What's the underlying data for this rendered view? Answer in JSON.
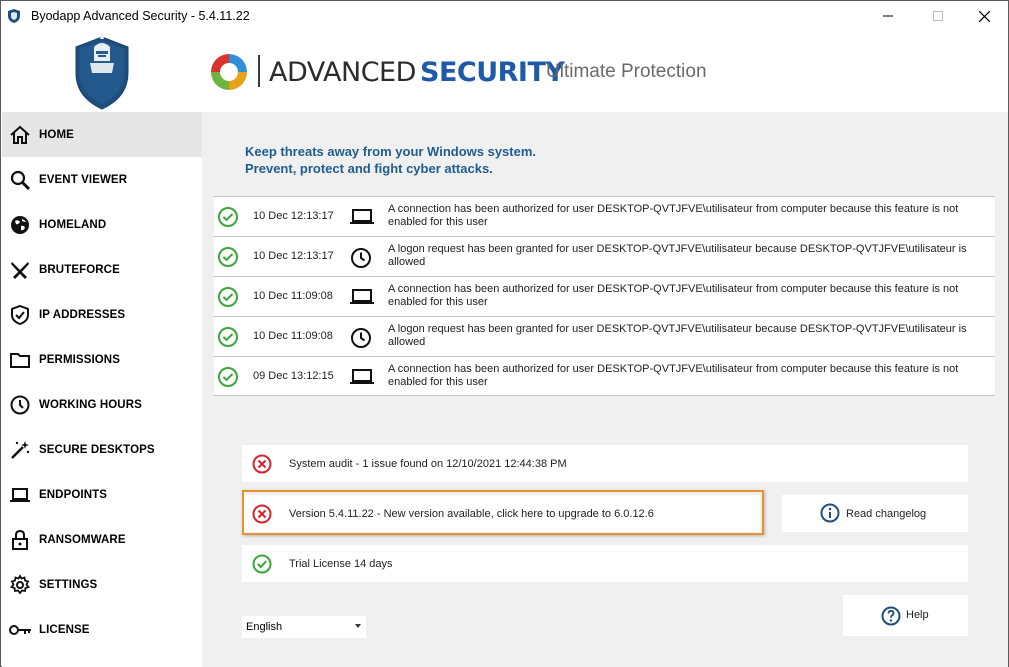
{
  "window": {
    "title": "Byodapp Advanced Security - 5.4.11.22"
  },
  "header": {
    "brand_advanced": "ADVANCED",
    "brand_security": "SECURITY",
    "tagline": "Ultimate Protection"
  },
  "sidebar": {
    "items": [
      {
        "label": "HOME",
        "icon": "home-icon",
        "active": true
      },
      {
        "label": "EVENT VIEWER",
        "icon": "magnifier-icon"
      },
      {
        "label": "HOMELAND",
        "icon": "globe-icon"
      },
      {
        "label": "BRUTEFORCE",
        "icon": "crossed-swords-icon"
      },
      {
        "label": "IP ADDRESSES",
        "icon": "shield-check-icon"
      },
      {
        "label": "PERMISSIONS",
        "icon": "folder-icon"
      },
      {
        "label": "WORKING HOURS",
        "icon": "clock-icon"
      },
      {
        "label": "SECURE DESKTOPS",
        "icon": "magic-wand-icon"
      },
      {
        "label": "ENDPOINTS",
        "icon": "laptop-icon"
      },
      {
        "label": "RANSOMWARE",
        "icon": "padlock-icon"
      },
      {
        "label": "SETTINGS",
        "icon": "gear-icon"
      },
      {
        "label": "LICENSE",
        "icon": "key-icon"
      }
    ]
  },
  "main": {
    "tagline_line1": "Keep threats away from your Windows system.",
    "tagline_line2": "Prevent, protect and fight cyber attacks.",
    "events": [
      {
        "date": "10 Dec 12:13:17",
        "type": "laptop-icon",
        "message": "A connection has been authorized for user DESKTOP-QVTJFVE\\utilisateur from computer  because this feature is not enabled for this user"
      },
      {
        "date": "10 Dec 12:13:17",
        "type": "clock-icon",
        "message": "A logon request has been granted for user DESKTOP-QVTJFVE\\utilisateur because DESKTOP-QVTJFVE\\utilisateur is allowed"
      },
      {
        "date": "10 Dec 11:09:08",
        "type": "laptop-icon",
        "message": "A connection has been authorized for user DESKTOP-QVTJFVE\\utilisateur from computer  because this feature is not enabled for this user"
      },
      {
        "date": "10 Dec 11:09:08",
        "type": "clock-icon",
        "message": "A logon request has been granted for user DESKTOP-QVTJFVE\\utilisateur because DESKTOP-QVTJFVE\\utilisateur is allowed"
      },
      {
        "date": "09 Dec 13:12:15",
        "type": "laptop-icon",
        "message": "A connection has been authorized for user DESKTOP-QVTJFVE\\utilisateur from computer  because this feature is not enabled for this user"
      }
    ],
    "audit_text": "System audit - 1 issue found on 12/10/2021 12:44:38 PM",
    "version_text": "Version 5.4.11.22 - New version available, click here to upgrade to 6.0.12.6",
    "changelog_label": "Read changelog",
    "license_text": "Trial License 14 days",
    "language": "English",
    "help_label": "Help"
  },
  "colors": {
    "accent": "#1e5aa8",
    "tagline": "#1f5c8f",
    "ok": "#3aa63a",
    "error": "#d9232d",
    "highlight": "#e8922e",
    "active_nav": "#e6e6e6",
    "panel_bg": "#f0f0f0"
  }
}
